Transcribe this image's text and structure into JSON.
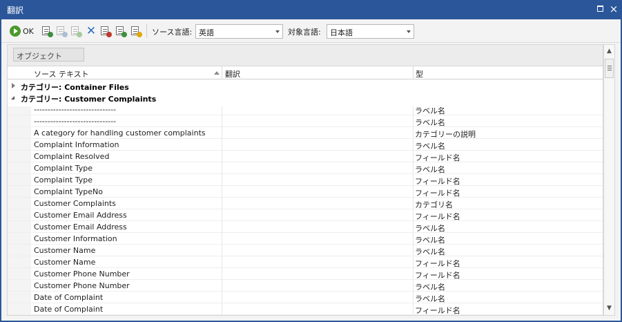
{
  "window": {
    "title": "翻訳",
    "maximize_label": "□",
    "close_label": "×"
  },
  "toolbar": {
    "ok_label": "OK",
    "source_lang_label": "ソース言語:",
    "source_lang_value": "英語",
    "target_lang_label": "対象言語:",
    "target_lang_value": "日本語"
  },
  "group_panel": {
    "chip_label": "オブジェクト"
  },
  "grid": {
    "columns": [
      "ソース テキスト",
      "翻訳",
      "型"
    ],
    "categories": [
      {
        "label": "カテゴリー: Container Files",
        "expanded": false
      },
      {
        "label": "カテゴリー: Customer Complaints",
        "expanded": true
      }
    ],
    "rows": [
      {
        "source": "------------------------------",
        "translation": "",
        "type": "ラベル名"
      },
      {
        "source": "------------------------------",
        "translation": "",
        "type": "ラベル名"
      },
      {
        "source": "A category for handling customer complaints",
        "translation": "",
        "type": "カテゴリーの説明"
      },
      {
        "source": "Complaint Information",
        "translation": "",
        "type": "ラベル名"
      },
      {
        "source": "Complaint Resolved",
        "translation": "",
        "type": "フィールド名"
      },
      {
        "source": "Complaint Type",
        "translation": "",
        "type": "ラベル名"
      },
      {
        "source": "Complaint Type",
        "translation": "",
        "type": "フィールド名"
      },
      {
        "source": "Complaint TypeNo",
        "translation": "",
        "type": "フィールド名"
      },
      {
        "source": "Customer Complaints",
        "translation": "",
        "type": "カテゴリ名"
      },
      {
        "source": "Customer Email Address",
        "translation": "",
        "type": "フィールド名"
      },
      {
        "source": "Customer Email Address",
        "translation": "",
        "type": "ラベル名"
      },
      {
        "source": "Customer Information",
        "translation": "",
        "type": "ラベル名"
      },
      {
        "source": "Customer Name",
        "translation": "",
        "type": "ラベル名"
      },
      {
        "source": "Customer Name",
        "translation": "",
        "type": "フィールド名"
      },
      {
        "source": "Customer Phone Number",
        "translation": "",
        "type": "フィールド名"
      },
      {
        "source": "Customer Phone Number",
        "translation": "",
        "type": "ラベル名"
      },
      {
        "source": "Date of Complaint",
        "translation": "",
        "type": "ラベル名"
      },
      {
        "source": "Date of Complaint",
        "translation": "",
        "type": "フィールド名"
      }
    ]
  },
  "colors": {
    "titlebar": "#2b579a",
    "ok_green": "#4a9a2c",
    "delete_blue": "#2e6fbe"
  },
  "icons": [
    "ok-icon",
    "export-icon",
    "import-icon",
    "web-translate-icon",
    "delete-icon",
    "translate-icon",
    "refresh-icon",
    "warning-icon"
  ]
}
